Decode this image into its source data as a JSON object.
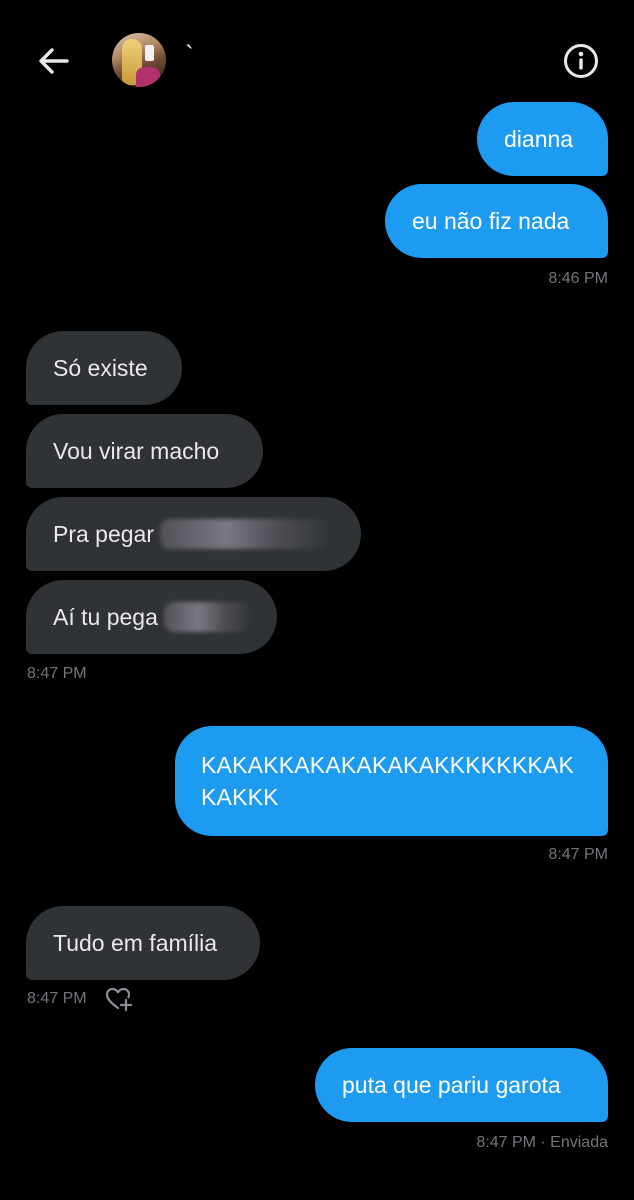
{
  "header": {
    "contact_name": "`"
  },
  "messages": [
    {
      "text": "dianna"
    },
    {
      "text": "eu não fiz nada"
    },
    {
      "time": "8:46 PM"
    },
    {
      "text": "Só existe"
    },
    {
      "text": "Vou virar macho"
    },
    {
      "text": "Pra pegar"
    },
    {
      "text": "Aí tu pega"
    },
    {
      "time": "8:47 PM"
    },
    {
      "text": "KAKAKKAKAKAKAKAKKKKKKKAKKAKKK"
    },
    {
      "time": "8:47 PM"
    },
    {
      "text": "Tudo em família"
    },
    {
      "time": "8:47 PM"
    },
    {
      "text": "puta que pariu garota"
    },
    {
      "time": "8:47 PM · Enviada"
    }
  ],
  "colors": {
    "outgoing_bubble": "#1d9bf0",
    "incoming_bubble": "#2f3336",
    "background": "#000000",
    "timestamp": "#71767b"
  },
  "icons": {
    "back": "arrow-left-icon",
    "info": "info-circle-icon",
    "react": "heart-plus-icon"
  }
}
